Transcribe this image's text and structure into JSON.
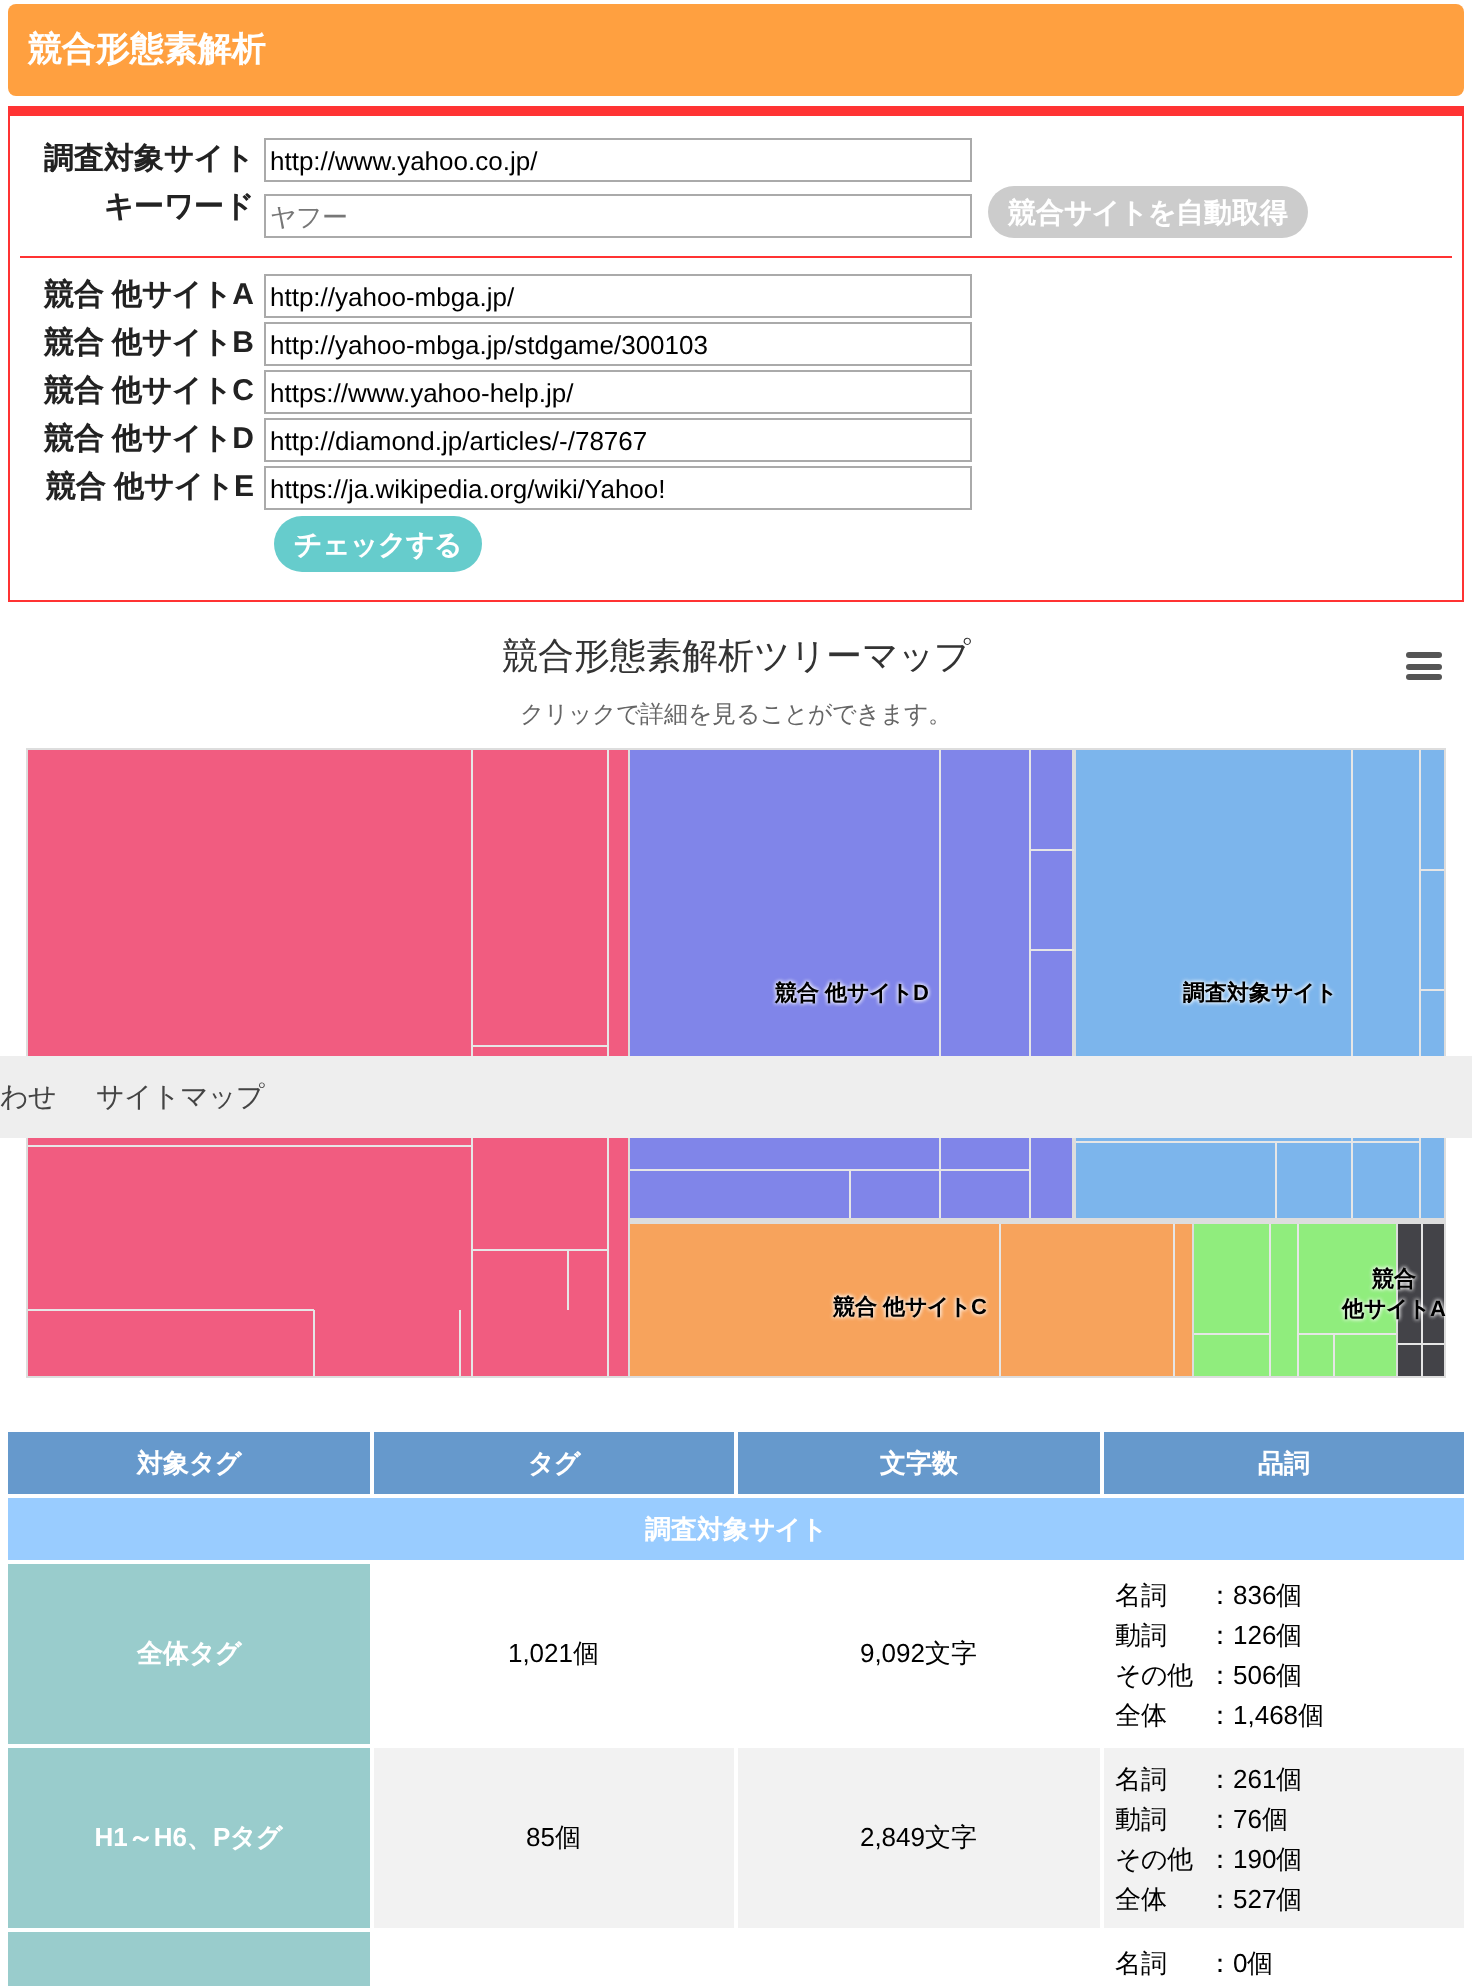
{
  "header": {
    "title": "競合形態素解析"
  },
  "form": {
    "target": {
      "label": "調査対象サイト",
      "value": "http://www.yahoo.co.jp/"
    },
    "keyword": {
      "label": "キーワード",
      "placeholder": "ヤフー"
    },
    "auto_button": {
      "label": "競合サイトを自動取得",
      "disabled": true
    },
    "competitors": [
      {
        "label": "競合 他サイトA",
        "value": "http://yahoo-mbga.jp/"
      },
      {
        "label": "競合 他サイトB",
        "value": "http://yahoo-mbga.jp/stdgame/300103"
      },
      {
        "label": "競合 他サイトC",
        "value": "https://www.yahoo-help.jp/"
      },
      {
        "label": "競合 他サイトD",
        "value": "http://diamond.jp/articles/-/78767"
      },
      {
        "label": "競合 他サイトE",
        "value": "https://ja.wikipedia.org/wiki/Yahoo!"
      }
    ],
    "check_button": {
      "label": "チェックする"
    }
  },
  "treemap": {
    "title": "競合形態素解析ツリーマップ",
    "subtitle": "クリックで詳細を見ることができます。",
    "groups": [
      {
        "color": "#f15c80"
      },
      {
        "color": "#8085e9",
        "label": "競合 他サイトD"
      },
      {
        "color": "#7cb5ec",
        "label": "調査対象サイト"
      },
      {
        "color": "#f7a35c",
        "label": "競合 他サイトC"
      },
      {
        "color": "#90ed7d",
        "label_lines": [
          "競合",
          "他サイトA"
        ]
      },
      {
        "color": "#434348"
      }
    ]
  },
  "nav_overlay": {
    "items": [
      "わせ",
      "サイトマップ"
    ]
  },
  "table": {
    "columns": [
      "対象タグ",
      "タグ",
      "文字数",
      "品詞"
    ],
    "section": "調査対象サイト",
    "rows": [
      {
        "tag": "全体タグ",
        "count": "1,021個",
        "chars": "9,092文字",
        "pos": [
          {
            "label": "名詞",
            "value": "：836個"
          },
          {
            "label": "動詞",
            "value": "：126個"
          },
          {
            "label": "その他",
            "value": "：506個"
          },
          {
            "label": "全体",
            "value": "：1,468個"
          }
        ]
      },
      {
        "tag": "H1～H6、Pタグ",
        "count": "85個",
        "chars": "2,849文字",
        "pos": [
          {
            "label": "名詞",
            "value": "：261個"
          },
          {
            "label": "動詞",
            "value": "：76個"
          },
          {
            "label": "その他",
            "value": "：190個"
          },
          {
            "label": "全体",
            "value": "：527個"
          }
        ]
      },
      {
        "pos": [
          {
            "label": "名詞",
            "value": "：0個"
          }
        ]
      }
    ]
  }
}
